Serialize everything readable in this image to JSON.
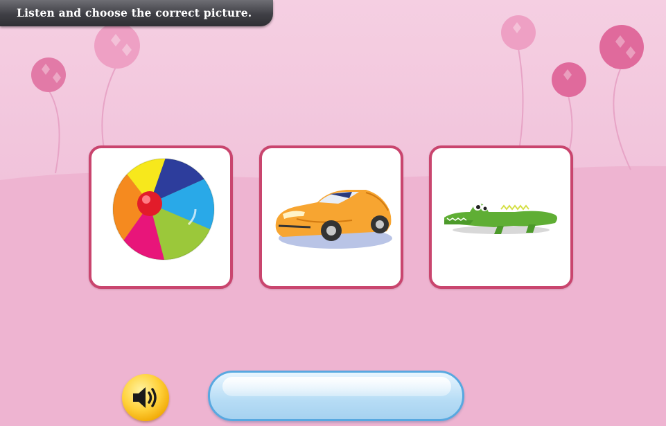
{
  "instruction": {
    "text": "Listen and choose the correct picture."
  },
  "options": [
    {
      "id": "ball",
      "icon": "beach-ball-icon"
    },
    {
      "id": "car",
      "icon": "car-icon"
    },
    {
      "id": "crocodile",
      "icon": "crocodile-icon"
    }
  ],
  "audio": {
    "icon": "speaker-icon"
  },
  "answer": {
    "value": ""
  },
  "colors": {
    "background": "#f3c9de",
    "card_border": "#c9456e",
    "banner": "#3f3f45",
    "flower": "#e0679a",
    "answer_border": "#58a8e0",
    "sound_button": "#ffd23c"
  }
}
